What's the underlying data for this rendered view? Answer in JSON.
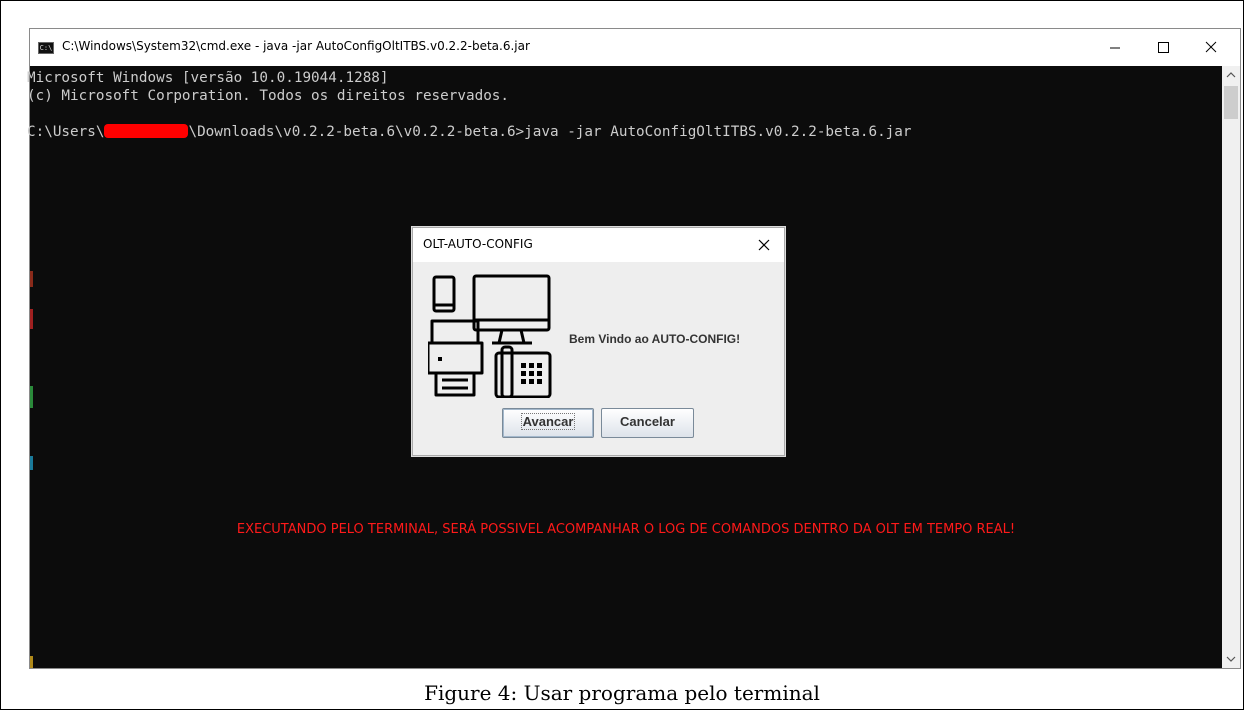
{
  "window": {
    "title": "C:\\Windows\\System32\\cmd.exe - java  -jar AutoConfigOltITBS.v0.2.2-beta.6.jar",
    "icon": "cmd-icon",
    "icon_text": "C:\\"
  },
  "console": {
    "line1": "Microsoft Windows [versão 10.0.19044.1288]",
    "line2": "(c) Microsoft Corporation. Todos os direitos reservados.",
    "prompt_prefix": "C:\\Users\\",
    "prompt_suffix": "\\Downloads\\v0.2.2-beta.6\\v0.2.2-beta.6>java -jar AutoConfigOltITBS.v0.2.2-beta.6.jar",
    "notice": "EXECUTANDO PELO TERMINAL, SERÁ POSSIVEL ACOMPANHAR O LOG DE COMANDOS DENTRO DA OLT EM TEMPO REAL!"
  },
  "dialog": {
    "title": "OLT-AUTO-CONFIG",
    "message": "Bem Vindo ao AUTO-CONFIG!",
    "ok_label": "Avancar",
    "cancel_label": "Cancelar",
    "illustration": "devices-illustration"
  },
  "caption": "Figure 4:  Usar programa pelo terminal",
  "colors": {
    "console_bg": "#0c0c0c",
    "console_text": "#cccccc",
    "notice_red": "#ff1a1a",
    "redaction": "#ff0000"
  }
}
